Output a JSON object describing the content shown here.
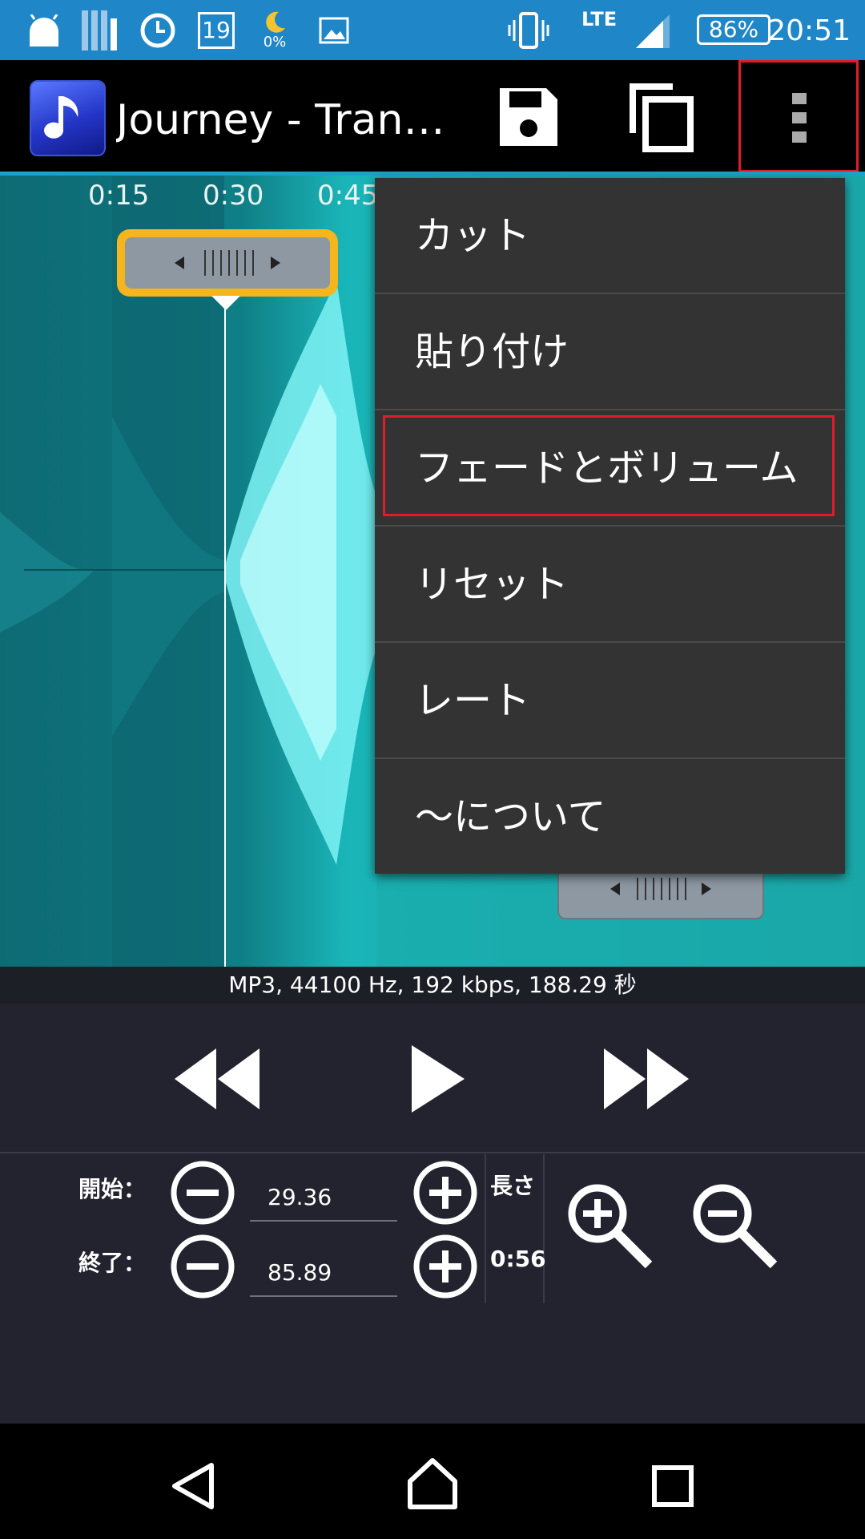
{
  "status_bar": {
    "calendar_day": "19",
    "moon_percent": "0%",
    "network": "LTE",
    "battery": "86%",
    "time": "20:51"
  },
  "action_bar": {
    "title": "Journey - Tranz...",
    "save_icon": "save-icon",
    "copy_icon": "copy-icon",
    "overflow_icon": "more-vertical-icon"
  },
  "waveform": {
    "ticks": [
      "0:15",
      "0:30",
      "0:45"
    ]
  },
  "file_info": "MP3, 44100 Hz, 192 kbps, 188.29 秒",
  "controls": {
    "start_label": "開始：",
    "end_label": "終了：",
    "start_value": "29.36",
    "end_value": "85.89",
    "length_label": "長さ",
    "length_value": "0:56"
  },
  "menu": {
    "items": [
      "カット",
      "貼り付け",
      "フェードとボリューム",
      "リセット",
      "レート",
      "～について"
    ],
    "selected_index": 2
  },
  "colors": {
    "status_bar": "#1f86c8",
    "waveform": "#1ab5b8",
    "highlight": "#e01b2a",
    "handle_border": "#f4b61c"
  }
}
